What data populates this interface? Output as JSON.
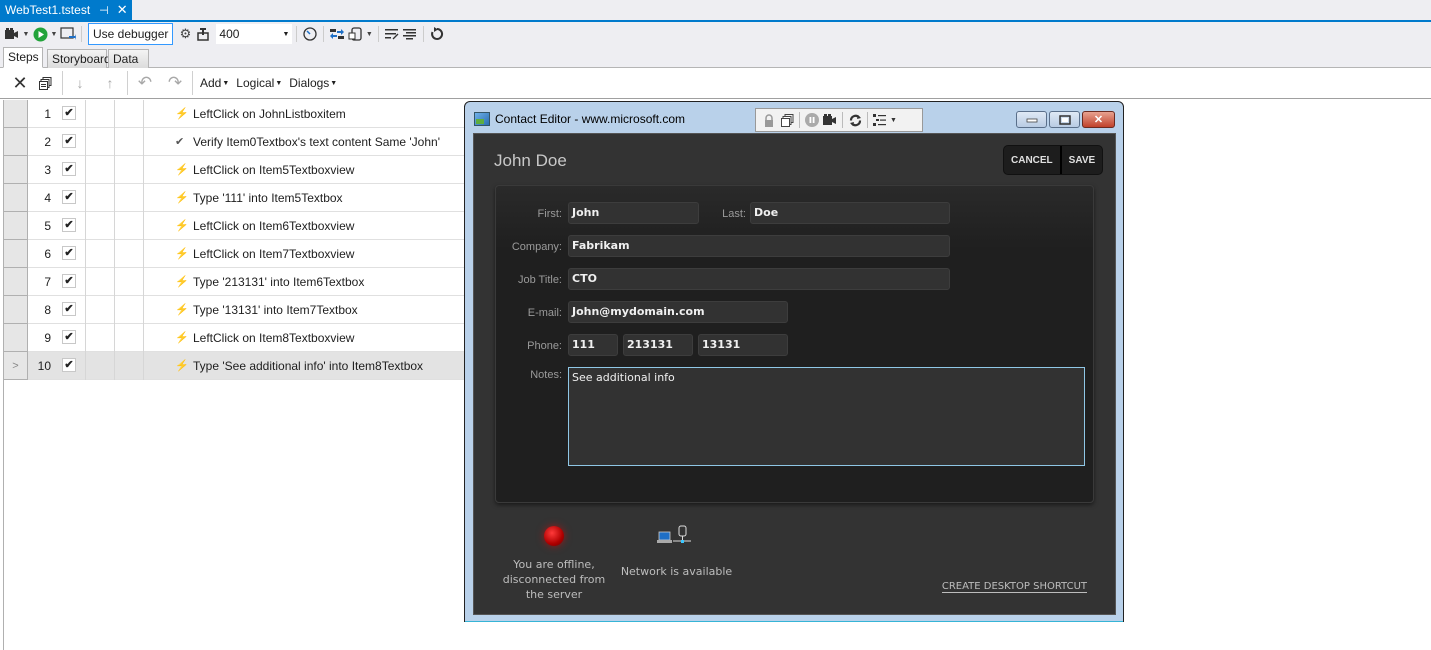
{
  "document_tab": {
    "title": "WebTest1.tstest",
    "pin_glyph": "⊣",
    "close_glyph": "✕"
  },
  "toolbar": {
    "debugger_label": "Use debugger",
    "speed_value": "400",
    "icons": [
      "record-icon",
      "run-icon",
      "window-icon",
      "gear-icon",
      "upload-icon",
      "timer-icon",
      "sync-icon",
      "database-icon",
      "format-icon",
      "align-icon",
      "reset-icon"
    ]
  },
  "subtabs": [
    {
      "label": "Steps",
      "active": true
    },
    {
      "label": "Storyboard",
      "active": false
    },
    {
      "label": "Data",
      "active": false
    }
  ],
  "steps_toolbar": {
    "menus": [
      {
        "label": "Add"
      },
      {
        "label": "Logical"
      },
      {
        "label": "Dialogs"
      }
    ]
  },
  "steps": [
    {
      "num": "1",
      "checked": true,
      "icon": "action",
      "text": "LeftClick on JohnListboxitem"
    },
    {
      "num": "2",
      "checked": true,
      "icon": "verify",
      "text": "Verify Item0Textbox's text content Same 'John'"
    },
    {
      "num": "3",
      "checked": true,
      "icon": "action",
      "text": "LeftClick on Item5Textboxview"
    },
    {
      "num": "4",
      "checked": true,
      "icon": "action",
      "text": "Type '111' into Item5Textbox"
    },
    {
      "num": "5",
      "checked": true,
      "icon": "action",
      "text": "LeftClick on Item6Textboxview"
    },
    {
      "num": "6",
      "checked": true,
      "icon": "action",
      "text": "LeftClick on Item7Textboxview"
    },
    {
      "num": "7",
      "checked": true,
      "icon": "action",
      "text": "Type '213131' into Item6Textbox"
    },
    {
      "num": "8",
      "checked": true,
      "icon": "action",
      "text": "Type '13131' into Item7Textbox"
    },
    {
      "num": "9",
      "checked": true,
      "icon": "action",
      "text": "LeftClick on Item8Textboxview"
    },
    {
      "num": "10",
      "checked": true,
      "icon": "action",
      "text": "Type 'See additional info' into Item8Textbox",
      "selected": true,
      "row_marker": ">"
    }
  ],
  "window": {
    "title": "Contact Editor - www.microsoft.com",
    "contact_name": "John Doe",
    "cancel_label": "CANCEL",
    "save_label": "SAVE",
    "form": {
      "first_label": "First:",
      "first": "John",
      "last_label": "Last:",
      "last": "Doe",
      "company_label": "Company:",
      "company": "Fabrikam",
      "job_label": "Job Title:",
      "job": "CTO",
      "email_label": "E-mail:",
      "email": "John@mydomain.com",
      "phone_label": "Phone:",
      "phone1": "111",
      "phone2": "213131",
      "phone3": "13131",
      "notes_label": "Notes:",
      "notes": "See additional info"
    },
    "status": {
      "offline_text": "You are offline, disconnected from the server",
      "network_text": "Network is available",
      "shortcut_label": "CREATE DESKTOP SHORTCUT",
      "offline_color": "#d00000"
    }
  }
}
